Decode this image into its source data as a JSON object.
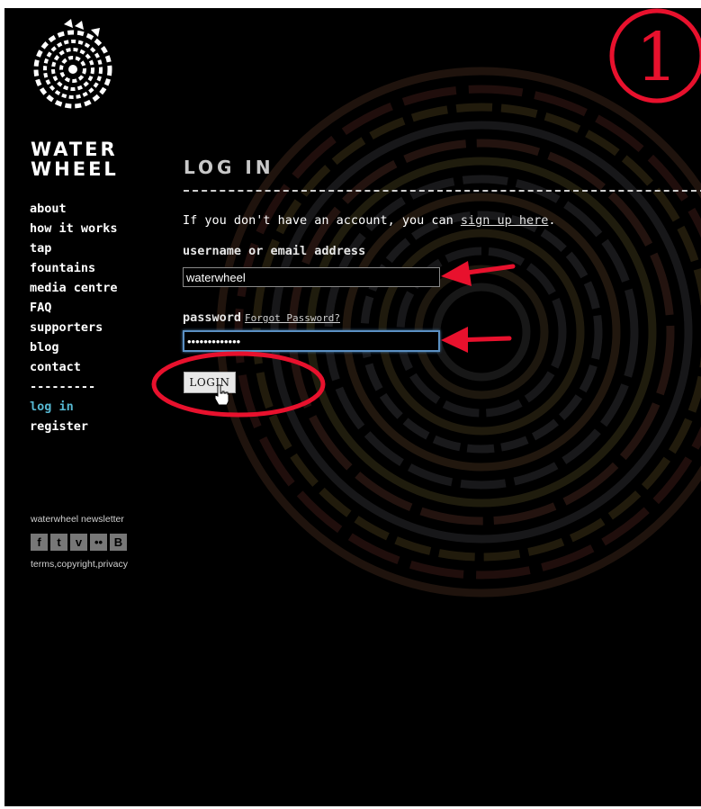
{
  "brand": {
    "line1": "WATER",
    "line2": "WHEEL"
  },
  "nav": {
    "items": [
      "about",
      "how it works",
      "tap",
      "fountains",
      "media centre",
      "FAQ",
      "supporters",
      "blog",
      "contact"
    ],
    "separator": "---------",
    "login": "log in",
    "register": "register"
  },
  "footer": {
    "newsletter": "waterwheel newsletter",
    "social": [
      {
        "icon": "facebook-icon",
        "glyph": "f"
      },
      {
        "icon": "twitter-icon",
        "glyph": "t"
      },
      {
        "icon": "vimeo-icon",
        "glyph": "v"
      },
      {
        "icon": "flickr-icon",
        "glyph": "••"
      },
      {
        "icon": "blogger-icon",
        "glyph": "B"
      }
    ],
    "legal": "terms,copyright,privacy"
  },
  "main": {
    "title": "LOG IN",
    "intro_text": "If you don't have an account, you can ",
    "intro_link": "sign up here",
    "intro_end": ".",
    "username_label": "username or email address",
    "username_value": "waterwheel",
    "password_label": "password",
    "forgot_link": "Forgot Password?",
    "password_value": "•••••••••••••",
    "login_button": "LOGIN"
  },
  "annotation": {
    "step_number": "1",
    "color": "#e8112d"
  },
  "colors": {
    "background": "#000000",
    "active_nav": "#56b8d2",
    "input_focus": "#5a8fc2"
  }
}
